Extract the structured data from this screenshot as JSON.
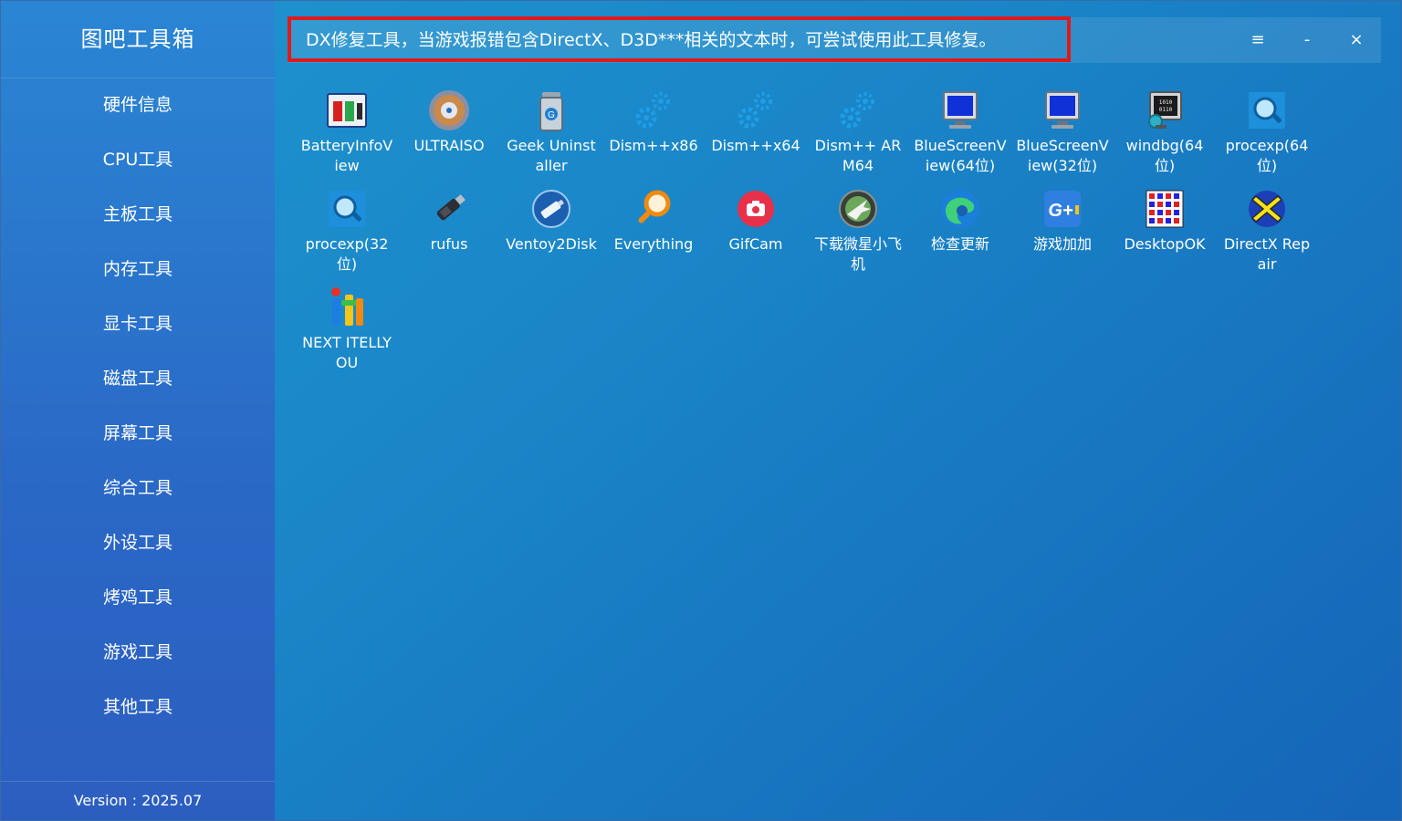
{
  "app": {
    "title": "图吧工具箱",
    "version": "Version : 2025.07"
  },
  "sidebar": {
    "items": [
      {
        "label": "硬件信息"
      },
      {
        "label": "CPU工具"
      },
      {
        "label": "主板工具"
      },
      {
        "label": "内存工具"
      },
      {
        "label": "显卡工具"
      },
      {
        "label": "磁盘工具"
      },
      {
        "label": "屏幕工具"
      },
      {
        "label": "综合工具"
      },
      {
        "label": "外设工具"
      },
      {
        "label": "烤鸡工具"
      },
      {
        "label": "游戏工具"
      },
      {
        "label": "其他工具"
      }
    ]
  },
  "topbar": {
    "tip": "DX修复工具，当游戏报错包含DirectX、D3D***相关的文本时，可尝试使用此工具修复。",
    "menu_icon": "≡",
    "minimize_icon": "-",
    "close_icon": "×"
  },
  "tools": [
    {
      "label": "BatteryInfoView",
      "icon": "battery-icon"
    },
    {
      "label": "ULTRAISO",
      "icon": "disc-icon"
    },
    {
      "label": "Geek Uninstaller",
      "icon": "trash-can-icon"
    },
    {
      "label": "Dism++x86",
      "icon": "gears-icon"
    },
    {
      "label": "Dism++x64",
      "icon": "gears-icon"
    },
    {
      "label": "Dism++ ARM64",
      "icon": "gears-icon"
    },
    {
      "label": "BlueScreenView(64位)",
      "icon": "monitor-icon"
    },
    {
      "label": "BlueScreenView(32位)",
      "icon": "monitor-icon"
    },
    {
      "label": "windbg(64位)",
      "icon": "debugger-icon"
    },
    {
      "label": "procexp(64位)",
      "icon": "magnifier-icon"
    },
    {
      "label": "procexp(32位)",
      "icon": "magnifier-icon"
    },
    {
      "label": "rufus",
      "icon": "usb-drive-icon"
    },
    {
      "label": "Ventoy2Disk",
      "icon": "ventoy-icon"
    },
    {
      "label": "Everything",
      "icon": "search-icon"
    },
    {
      "label": "GifCam",
      "icon": "camera-icon"
    },
    {
      "label": "下载微星小飞机",
      "icon": "airplane-icon"
    },
    {
      "label": "检查更新",
      "icon": "edge-icon"
    },
    {
      "label": "游戏加加",
      "icon": "game-plus-icon"
    },
    {
      "label": "DesktopOK",
      "icon": "desktop-grid-icon"
    },
    {
      "label": "DirectX Repair",
      "icon": "directx-icon"
    },
    {
      "label": "NEXT ITELLYOU",
      "icon": "itellyou-icon"
    }
  ],
  "colors": {
    "highlight_border": "#e11919",
    "accent": "#1a86c8"
  }
}
